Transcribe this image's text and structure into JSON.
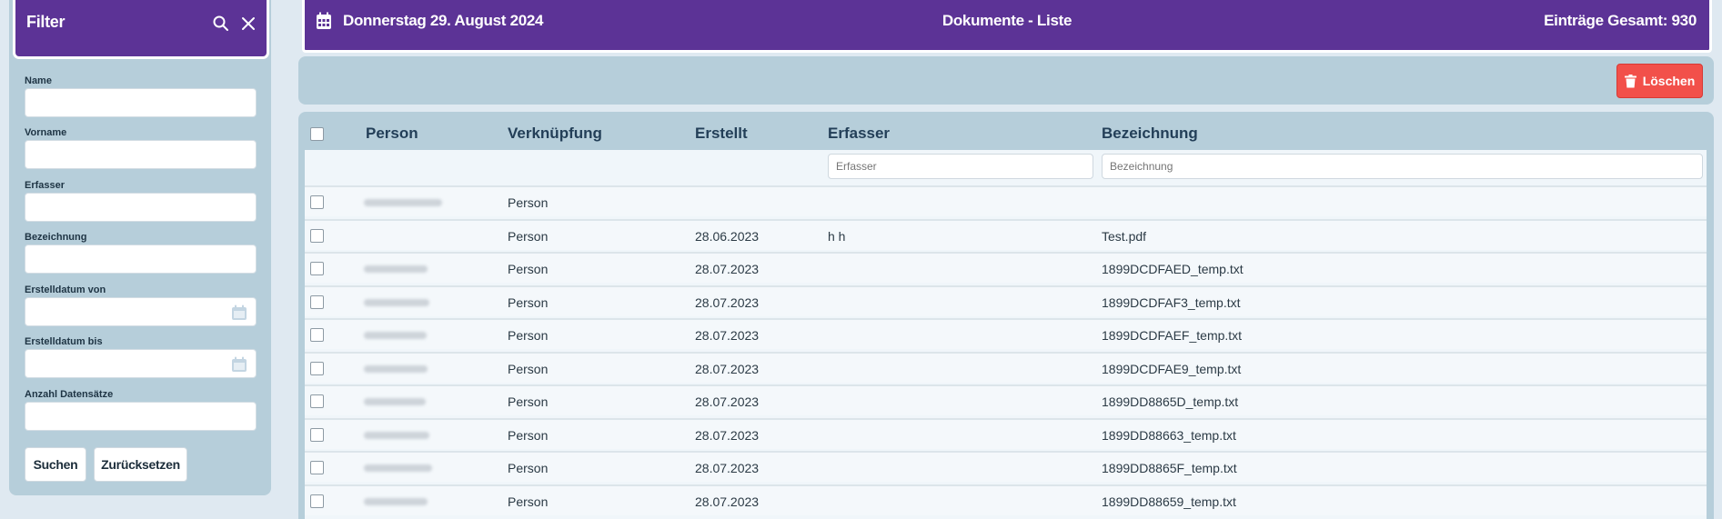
{
  "filter": {
    "title": "Filter",
    "fields": [
      {
        "label": "Name",
        "value": ""
      },
      {
        "label": "Vorname",
        "value": ""
      },
      {
        "label": "Erfasser",
        "value": ""
      },
      {
        "label": "Bezeichnung",
        "value": ""
      },
      {
        "label": "Erstelldatum von",
        "value": ""
      },
      {
        "label": "Erstelldatum bis",
        "value": ""
      },
      {
        "label": "Anzahl Datensätze",
        "value": ""
      }
    ],
    "search_label": "Suchen",
    "reset_label": "Zurücksetzen"
  },
  "header": {
    "date": "Donnerstag 29. August 2024",
    "title": "Dokumente - Liste",
    "total": "Einträge Gesamt: 930"
  },
  "toolbar": {
    "delete_label": "Löschen"
  },
  "table": {
    "columns": [
      "Person",
      "Verknüpfung",
      "Erstellt",
      "Erfasser",
      "Bezeichnung"
    ],
    "erfasser_placeholder": "Erfasser",
    "bezeichnung_placeholder": "Bezeichnung",
    "rows": [
      {
        "person": "",
        "verknuepfung": "Person",
        "erstellt": "",
        "erfasser": "",
        "bezeichnung": ""
      },
      {
        "person": "",
        "verknuepfung": "Person",
        "erstellt": "28.06.2023",
        "erfasser": "h h",
        "bezeichnung": "Test.pdf"
      },
      {
        "person": "",
        "verknuepfung": "Person",
        "erstellt": "28.07.2023",
        "erfasser": "",
        "bezeichnung": "1899DCDFAED_temp.txt"
      },
      {
        "person": "",
        "verknuepfung": "Person",
        "erstellt": "28.07.2023",
        "erfasser": "",
        "bezeichnung": "1899DCDFAF3_temp.txt"
      },
      {
        "person": "",
        "verknuepfung": "Person",
        "erstellt": "28.07.2023",
        "erfasser": "",
        "bezeichnung": "1899DCDFAEF_temp.txt"
      },
      {
        "person": "",
        "verknuepfung": "Person",
        "erstellt": "28.07.2023",
        "erfasser": "",
        "bezeichnung": "1899DCDFAE9_temp.txt"
      },
      {
        "person": "",
        "verknuepfung": "Person",
        "erstellt": "28.07.2023",
        "erfasser": "",
        "bezeichnung": "1899DD8865D_temp.txt"
      },
      {
        "person": "",
        "verknuepfung": "Person",
        "erstellt": "28.07.2023",
        "erfasser": "",
        "bezeichnung": "1899DD88663_temp.txt"
      },
      {
        "person": "",
        "verknuepfung": "Person",
        "erstellt": "28.07.2023",
        "erfasser": "",
        "bezeichnung": "1899DD8865F_temp.txt"
      },
      {
        "person": "",
        "verknuepfung": "Person",
        "erstellt": "28.07.2023",
        "erfasser": "",
        "bezeichnung": "1899DD88659_temp.txt"
      }
    ]
  },
  "colors": {
    "header_purple": "#5c3396",
    "panel_blue": "#b6ceda",
    "delete_red": "#f2504a"
  }
}
